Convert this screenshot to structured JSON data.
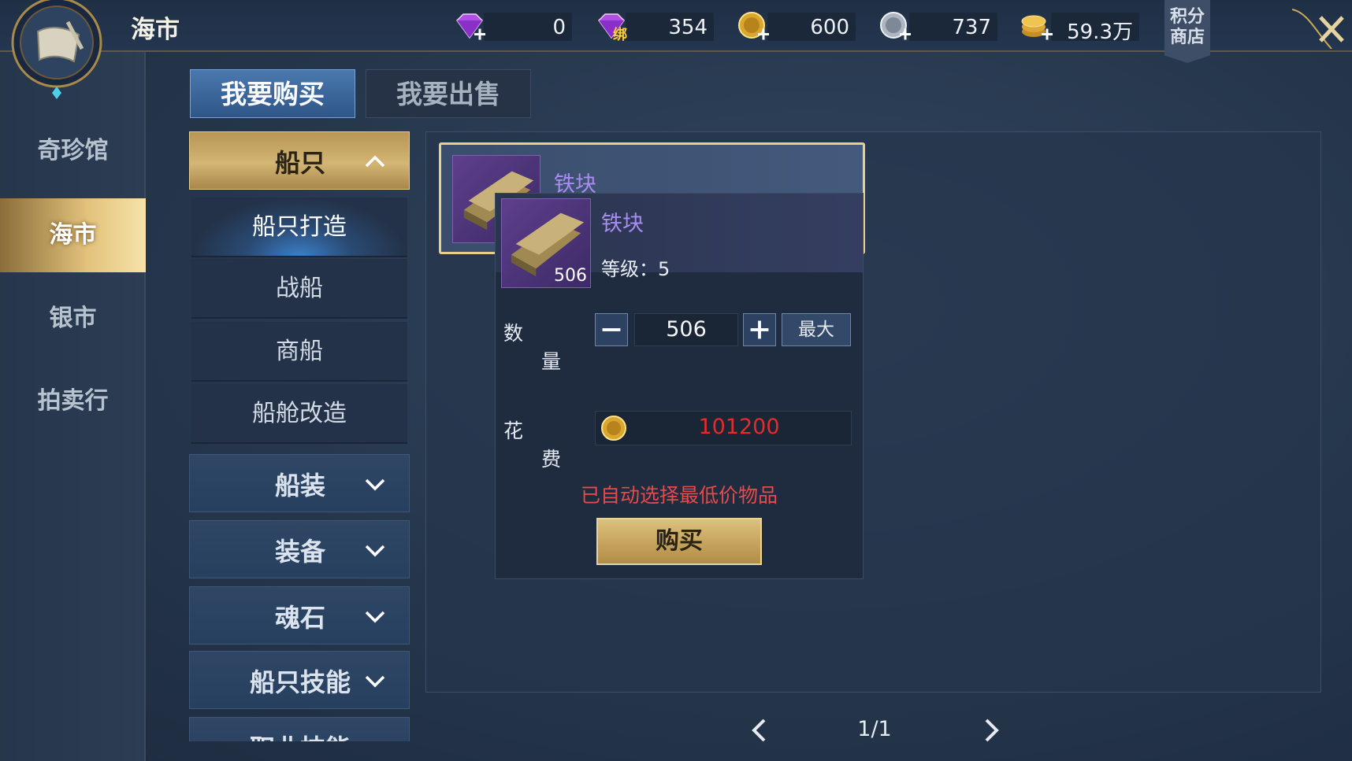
{
  "header": {
    "title": "海市",
    "shop_label_line1": "积分",
    "shop_label_line2": "商店"
  },
  "currencies": [
    {
      "name": "diamond",
      "value": "0"
    },
    {
      "name": "bound-diamond",
      "badge": "绑",
      "value": "354"
    },
    {
      "name": "gold-coin",
      "value": "600"
    },
    {
      "name": "silver-coin",
      "value": "737"
    },
    {
      "name": "gold-stack",
      "value": "59.3万"
    }
  ],
  "left_nav": {
    "items": [
      {
        "label": "奇珍馆",
        "active": false
      },
      {
        "label": "海市",
        "active": true
      },
      {
        "label": "银市",
        "active": false
      },
      {
        "label": "拍卖行",
        "active": false
      }
    ]
  },
  "tabs": {
    "buy": "我要购买",
    "sell": "我要出售"
  },
  "categories": {
    "ships": "船只",
    "ships_sub": [
      "船只打造",
      "战船",
      "商船",
      "船舱改造"
    ],
    "others": [
      "船装",
      "装备",
      "魂石",
      "船只技能",
      "职业技能"
    ]
  },
  "item_card": {
    "name": "铁块"
  },
  "popup": {
    "name": "铁块",
    "count": "506",
    "level": "等级：5",
    "qty_label_1": "数",
    "qty_label_2": "量",
    "qty_value": "506",
    "max_label": "最大",
    "cost_label_1": "花",
    "cost_label_2": "费",
    "cost_value": "101200",
    "note": "已自动选择最低价物品",
    "buy_label": "购买"
  },
  "pager": {
    "text": "1/1"
  },
  "colors": {
    "accent_gold": "#d3b574",
    "item_purple": "#a98cf0",
    "cost_red": "#e52b2b"
  }
}
